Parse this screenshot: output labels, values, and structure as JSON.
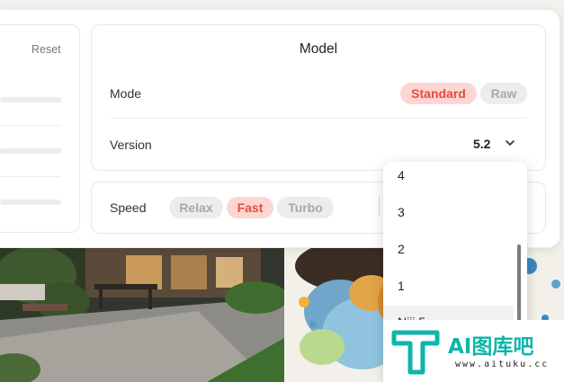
{
  "left_panel": {
    "reset_label": "Reset"
  },
  "model": {
    "title": "Model",
    "mode": {
      "label": "Mode",
      "options": [
        "Standard",
        "Raw"
      ],
      "selected": "Standard"
    },
    "version": {
      "label": "Version",
      "value": "5.2",
      "icon": "chevron-down-icon"
    }
  },
  "speed": {
    "label": "Speed",
    "options": [
      "Relax",
      "Fast",
      "Turbo"
    ],
    "selected": "Fast"
  },
  "version_dropdown": {
    "items": [
      "4",
      "3",
      "2",
      "1",
      "Niji 5"
    ]
  },
  "watermark": {
    "logo_text": "AI图库吧",
    "url": "www.aituku.cc"
  },
  "colors": {
    "accent": "#e64a3c",
    "accent_bg": "#fcd6d3",
    "inactive_bg": "#ececec",
    "inactive_text": "#a9a9a9",
    "watermark": "#0fb5a9"
  }
}
